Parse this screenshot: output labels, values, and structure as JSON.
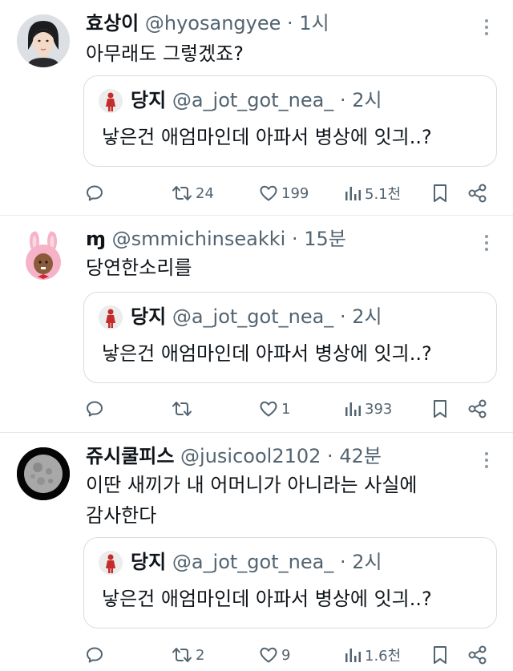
{
  "quoted": {
    "name": "당지",
    "handle": "@a_jot_got_nea_",
    "time": "2시",
    "text": "낳은건 애엄마인데 아파서 병상에 잇긔..?"
  },
  "tweets": [
    {
      "name": "효상이",
      "handle": "@hyosangyee",
      "time": "1시",
      "text_lines": [
        "아무래도 그렇겠죠?"
      ],
      "replies": "",
      "retweets": "24",
      "likes": "199",
      "views": "5.1천"
    },
    {
      "name": "ɱ",
      "handle": "@smmichinseakki",
      "time": "15분",
      "text_lines": [
        "당연한소리를"
      ],
      "replies": "",
      "retweets": "",
      "likes": "1",
      "views": "393"
    },
    {
      "name": "쥬시쿨피스",
      "handle": "@jusicool2102",
      "time": "42분",
      "text_lines": [
        "이딴 새끼가 내 어머니가 아니라는 사실에",
        "감사한다"
      ],
      "replies": "",
      "retweets": "2",
      "likes": "9",
      "views": "1.6천"
    }
  ],
  "separator": "·",
  "colors": {
    "text": "#0f1419",
    "muted": "#536471",
    "border": "#d7dde1"
  }
}
